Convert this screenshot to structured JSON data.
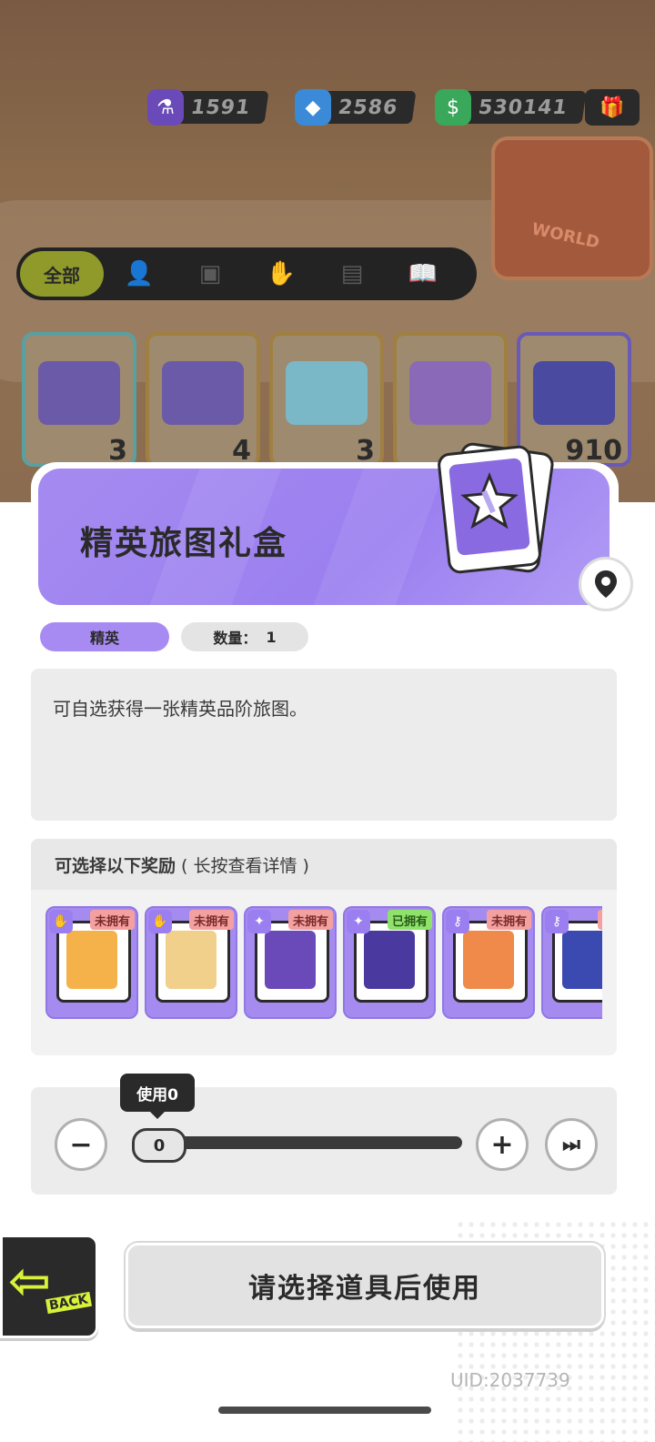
{
  "currencies": [
    {
      "icon": "potion-icon",
      "value": "1591"
    },
    {
      "icon": "diamond-icon",
      "value": "2586"
    },
    {
      "icon": "cash-icon",
      "value": "530141"
    }
  ],
  "filter_tabs": {
    "all_label": "全部",
    "icons": [
      "person-icon",
      "box-icon",
      "hand-icon",
      "card-icon",
      "book-icon"
    ]
  },
  "inventory": [
    {
      "count": "3",
      "color": "#6a5aa8"
    },
    {
      "count": "4",
      "color": "#6a5aa8"
    },
    {
      "count": "3",
      "color": "#7ab8c8"
    },
    {
      "count": "",
      "color": "#8a6ab8"
    },
    {
      "count": "910",
      "color": "#4a4aa0"
    }
  ],
  "item": {
    "title": "精英旅图礼盒",
    "rarity": "精英",
    "quantity_label": "数量：",
    "quantity": "1",
    "description": "可自选获得一张精英品阶旅图。"
  },
  "rewards": {
    "header": "可选择以下奖励",
    "header_sub": "( 长按查看详情 )",
    "items": [
      {
        "status": "未拥有",
        "owned": false,
        "color": "#f5b24a"
      },
      {
        "status": "未拥有",
        "owned": false,
        "color": "#f0d08a"
      },
      {
        "status": "未拥有",
        "owned": false,
        "color": "#6a4ab8"
      },
      {
        "status": "已拥有",
        "owned": true,
        "color": "#4a3aa0"
      },
      {
        "status": "未拥有",
        "owned": false,
        "color": "#f08a4a"
      },
      {
        "status": "未拥",
        "owned": false,
        "color": "#3a4ab0"
      }
    ]
  },
  "slider": {
    "tooltip": "使用0",
    "value": "0",
    "minus": "−",
    "plus": "+",
    "max": "⏭"
  },
  "back_label": "BACK",
  "use_button": "请选择道具后使用",
  "uid": "UID:2037739",
  "colors": {
    "accent": "#a58bf0",
    "owned": "#8ee26a",
    "not_owned": "#f4a0a0"
  }
}
